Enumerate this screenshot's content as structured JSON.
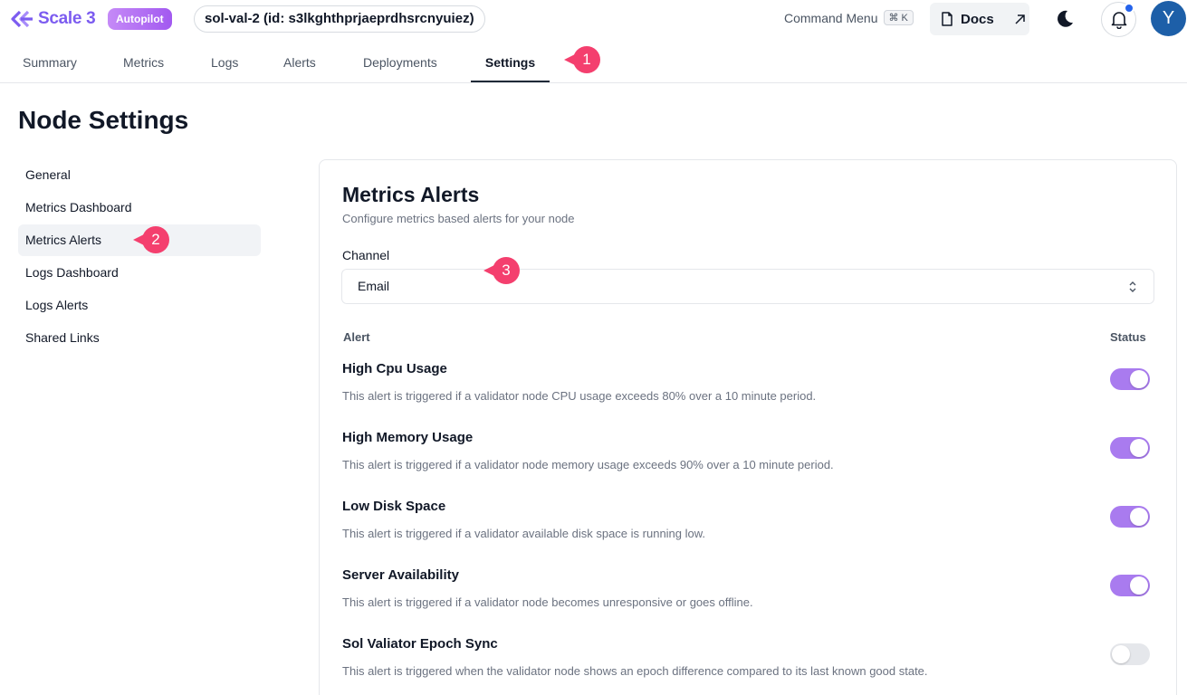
{
  "header": {
    "logo_text": "Scale 3",
    "badge": "Autopilot",
    "node_label": "sol-val-2 (id: s3lkghthprjaeprdhsrcnyuiez)",
    "command_menu": "Command Menu",
    "command_shortcut": "⌘ K",
    "docs_label": "Docs",
    "avatar_initial": "Y",
    "brand_color": "#7c5cf0",
    "notification_dot_color": "#2563eb"
  },
  "tabs": [
    {
      "label": "Summary",
      "active": false
    },
    {
      "label": "Metrics",
      "active": false
    },
    {
      "label": "Logs",
      "active": false
    },
    {
      "label": "Alerts",
      "active": false
    },
    {
      "label": "Deployments",
      "active": false
    },
    {
      "label": "Settings",
      "active": true
    }
  ],
  "callouts": [
    "1",
    "2",
    "3"
  ],
  "page_title": "Node Settings",
  "sidebar": {
    "items": [
      {
        "label": "General",
        "active": false
      },
      {
        "label": "Metrics Dashboard",
        "active": false
      },
      {
        "label": "Metrics Alerts",
        "active": true
      },
      {
        "label": "Logs Dashboard",
        "active": false
      },
      {
        "label": "Logs Alerts",
        "active": false
      },
      {
        "label": "Shared Links",
        "active": false
      }
    ]
  },
  "card": {
    "title": "Metrics Alerts",
    "subtitle": "Configure metrics based alerts for your node",
    "channel_label": "Channel",
    "channel_value": "Email",
    "col_alert": "Alert",
    "col_status": "Status",
    "alerts": [
      {
        "name": "High Cpu Usage",
        "description": "This alert is triggered if a validator node CPU usage exceeds 80% over a 10 minute period.",
        "enabled": true
      },
      {
        "name": "High Memory Usage",
        "description": "This alert is triggered if a validator node memory usage exceeds 90% over a 10 minute period.",
        "enabled": true
      },
      {
        "name": "Low Disk Space",
        "description": "This alert is triggered if a validator available disk space is running low.",
        "enabled": true
      },
      {
        "name": "Server Availability",
        "description": "This alert is triggered if a validator node becomes unresponsive or goes offline.",
        "enabled": true
      },
      {
        "name": "Sol Valiator Epoch Sync",
        "description": "This alert is triggered when the validator node shows an epoch difference compared to its last known good state.",
        "enabled": false
      }
    ],
    "toggle_on_color": "#a97bef"
  }
}
